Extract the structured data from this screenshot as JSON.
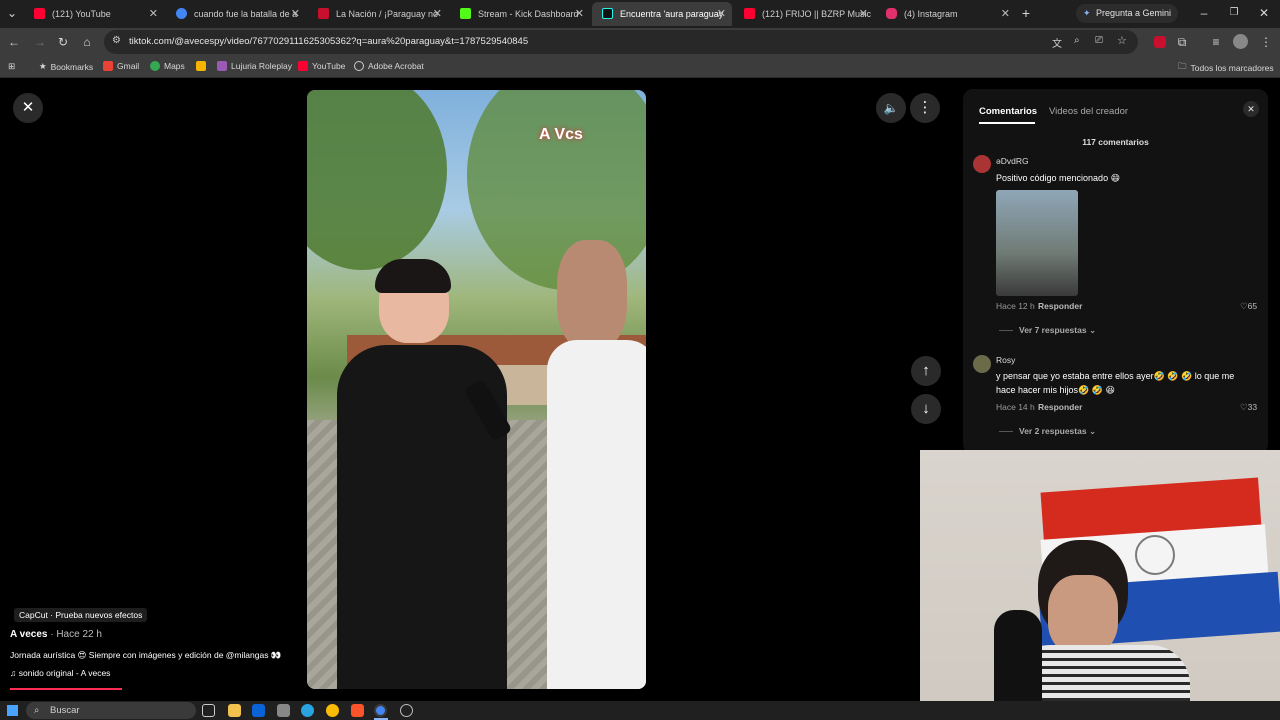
{
  "tabs": [
    {
      "title": "(121) YouTube",
      "color": "#ff0033"
    },
    {
      "title": "cuando fue la batalla de a",
      "color": "#4285f4"
    },
    {
      "title": "La Nación / ¡Paraguay no",
      "color": "#c8102e"
    },
    {
      "title": "Stream - Kick Dashboard",
      "color": "#53fc18"
    },
    {
      "title": "Encuentra 'aura paraguay",
      "color": "#111111"
    },
    {
      "title": "(121) FRIJO || BZRP Music",
      "color": "#ff0033"
    },
    {
      "title": "(4) Instagram",
      "color": "#e1306c"
    }
  ],
  "gemini_label": "Pregunta a Gemini",
  "url": "tiktok.com/@avecespy/video/7677029111625305362?q=aura%20paraguay&t=1787529540845",
  "bookmarks": [
    {
      "label": "Bookmarks",
      "color": "#cccccc"
    },
    {
      "label": "Gmail",
      "color": "#ea4335"
    },
    {
      "label": "Maps",
      "color": "#34a853"
    },
    {
      "label": "",
      "color": "#f4b400"
    },
    {
      "label": "Lujuria Roleplay",
      "color": "#9b59b6"
    },
    {
      "label": "YouTube",
      "color": "#ff0033"
    },
    {
      "label": "Adobe Acrobat",
      "color": "#cccccc"
    }
  ],
  "all_bookmarks_label": "Todos los marcadores",
  "video": {
    "overlay_logo": "A Vcs",
    "effect_label": "CapCut · Prueba nuevos efectos",
    "author": "A veces",
    "time": "· Hace 22 h",
    "description": "Jornada aurística 😍 Siempre con imágenes y edición de @milangas 👀",
    "sound": "sonido original - A veces"
  },
  "panel": {
    "tab_comments": "Comentarios",
    "tab_creator": "Videos del creador",
    "count": "117 comentarios",
    "comments": [
      {
        "user": "ǝDvdRG",
        "text": "Positivo código mencionado 😄",
        "time": "Hace 12 h",
        "reply": "Responder",
        "likes": "65",
        "more": "Ver 7 respuestas"
      },
      {
        "user": "Rosy",
        "text": "y pensar que yo estaba entre ellos ayer🤣 🤣 🤣 lo que me hace hacer mis hijos🤣 🤣 😆",
        "time": "Hace 14 h",
        "reply": "Responder",
        "likes": "33",
        "more": "Ver 2 respuestas"
      }
    ]
  },
  "taskbar": {
    "search_placeholder": "Buscar"
  }
}
